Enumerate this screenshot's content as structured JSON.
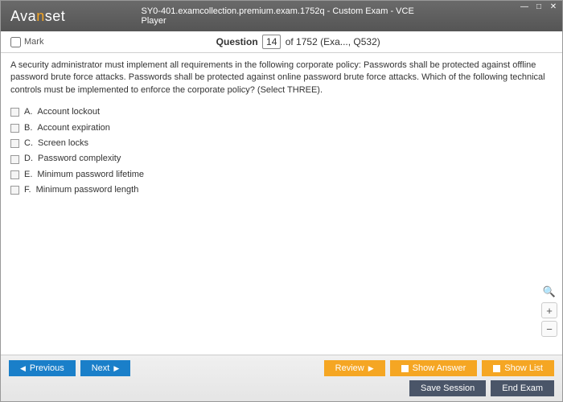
{
  "titlebar": {
    "logo_pre": "Ava",
    "logo_orange": "n",
    "logo_post": "set",
    "title": "SY0-401.examcollection.premium.exam.1752q - Custom Exam - VCE Player"
  },
  "header": {
    "mark_label": "Mark",
    "question_word": "Question",
    "question_num": "14",
    "question_total": " of 1752 (Exa..., Q532)"
  },
  "question": {
    "text": "A security administrator must implement all requirements in the following corporate policy: Passwords shall be protected against offline password brute force attacks. Passwords shall be protected against online password brute force attacks. Which of the following technical controls must be implemented to enforce the corporate policy? (Select THREE).",
    "options": [
      {
        "letter": "A.",
        "text": "Account lockout"
      },
      {
        "letter": "B.",
        "text": "Account expiration"
      },
      {
        "letter": "C.",
        "text": "Screen locks"
      },
      {
        "letter": "D.",
        "text": "Password complexity"
      },
      {
        "letter": "E.",
        "text": "Minimum password lifetime"
      },
      {
        "letter": "F.",
        "text": "Minimum password length"
      }
    ]
  },
  "footer": {
    "previous": "Previous",
    "next": "Next",
    "review": "Review",
    "show_answer": "Show Answer",
    "show_list": "Show List",
    "save_session": "Save Session",
    "end_exam": "End Exam"
  },
  "zoom": {
    "plus": "+",
    "minus": "−"
  }
}
